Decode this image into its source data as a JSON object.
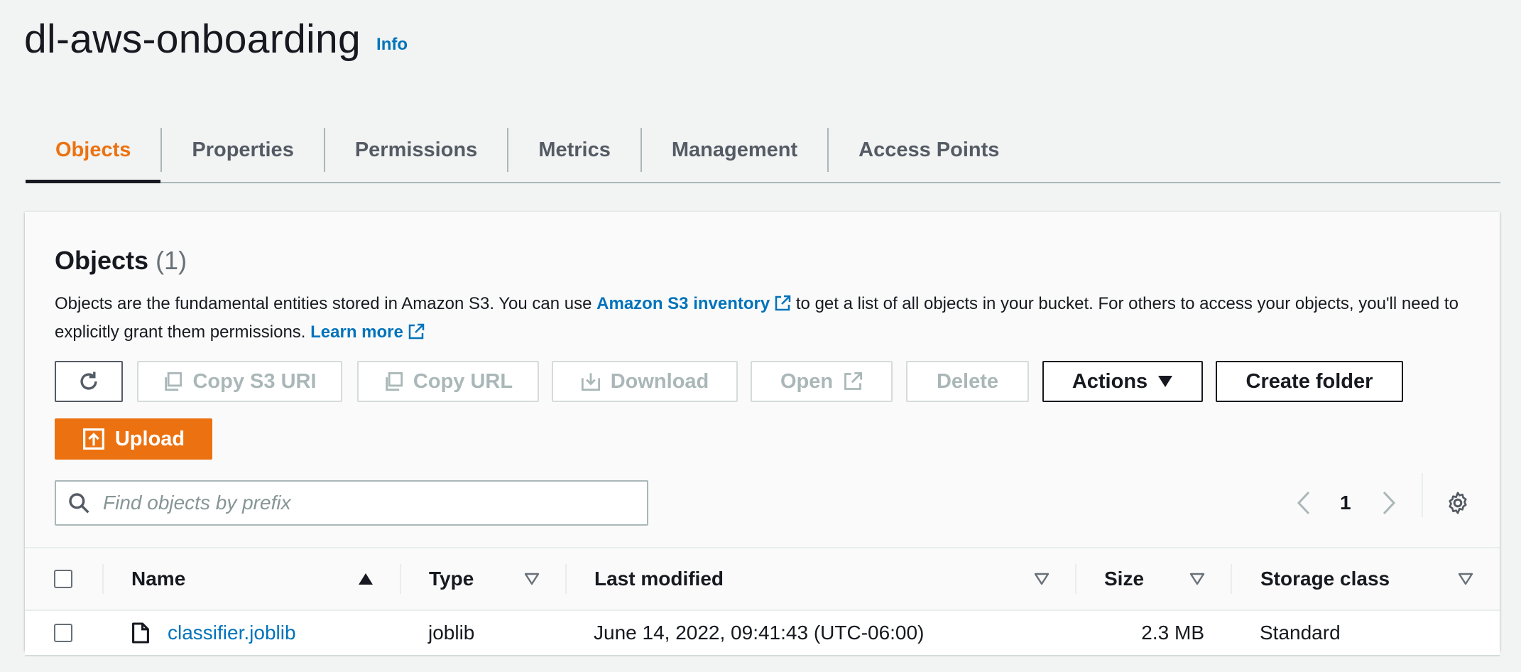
{
  "header": {
    "title": "dl-aws-onboarding",
    "info": "Info"
  },
  "tabs": [
    {
      "label": "Objects",
      "active": true
    },
    {
      "label": "Properties"
    },
    {
      "label": "Permissions"
    },
    {
      "label": "Metrics"
    },
    {
      "label": "Management"
    },
    {
      "label": "Access Points"
    }
  ],
  "panel": {
    "title": "Objects",
    "count": "(1)",
    "desc_part1": "Objects are the fundamental entities stored in Amazon S3. You can use ",
    "desc_link1": "Amazon S3 inventory",
    "desc_part2": " to get a list of all objects in your bucket. For others to access your objects, you'll need to explicitly grant them permissions. ",
    "desc_link2": "Learn more"
  },
  "toolbar": {
    "copy_s3_uri": "Copy S3 URI",
    "copy_url": "Copy URL",
    "download": "Download",
    "open": "Open",
    "delete": "Delete",
    "actions": "Actions",
    "create_folder": "Create folder",
    "upload": "Upload"
  },
  "search": {
    "placeholder": "Find objects by prefix",
    "value": ""
  },
  "pagination": {
    "current_page": "1"
  },
  "table": {
    "columns": [
      "Name",
      "Type",
      "Last modified",
      "Size",
      "Storage class"
    ],
    "rows": [
      {
        "name": "classifier.joblib",
        "type": "joblib",
        "last_modified": "June 14, 2022, 09:41:43 (UTC-06:00)",
        "size": "2.3 MB",
        "storage_class": "Standard"
      }
    ]
  },
  "colors": {
    "accent": "#ec7211",
    "link": "#0073bb",
    "text": "#16191f",
    "muted": "#545b64"
  }
}
